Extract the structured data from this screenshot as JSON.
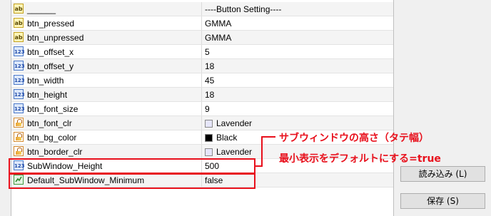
{
  "properties": [
    {
      "icon": "ab",
      "name": "______",
      "value": "----Button Setting----"
    },
    {
      "icon": "ab",
      "name": "btn_pressed",
      "value": "GMMA"
    },
    {
      "icon": "ab",
      "name": "btn_unpressed",
      "value": "GMMA"
    },
    {
      "icon": "num",
      "name": "btn_offset_x",
      "value": "5"
    },
    {
      "icon": "num",
      "name": "btn_offset_y",
      "value": "18"
    },
    {
      "icon": "num",
      "name": "btn_width",
      "value": "45"
    },
    {
      "icon": "num",
      "name": "btn_height",
      "value": "18"
    },
    {
      "icon": "num",
      "name": "btn_font_size",
      "value": "9"
    },
    {
      "icon": "clr",
      "name": "btn_font_clr",
      "value": "Lavender",
      "swatch": "#e6e6fa"
    },
    {
      "icon": "clr",
      "name": "btn_bg_color",
      "value": "Black",
      "swatch": "#000000"
    },
    {
      "icon": "clr",
      "name": "btn_border_clr",
      "value": "Lavender",
      "swatch": "#e6e6fa"
    },
    {
      "icon": "num",
      "name": "SubWindow_Height",
      "value": "500"
    },
    {
      "icon": "bool",
      "name": "Default_SubWindow_Minimum",
      "value": "false"
    }
  ],
  "annotations": {
    "height_note": "サブウィンドウの高さ（タテ幅）",
    "minimum_note": "最小表示をデフォルトにする=true",
    "color": "#e8101c"
  },
  "buttons": {
    "load": "読み込み (L)",
    "save": "保存 (S)"
  },
  "icon_names": {
    "ab": "string-icon",
    "num": "integer-icon",
    "clr": "color-icon",
    "bool": "boolean-icon"
  }
}
